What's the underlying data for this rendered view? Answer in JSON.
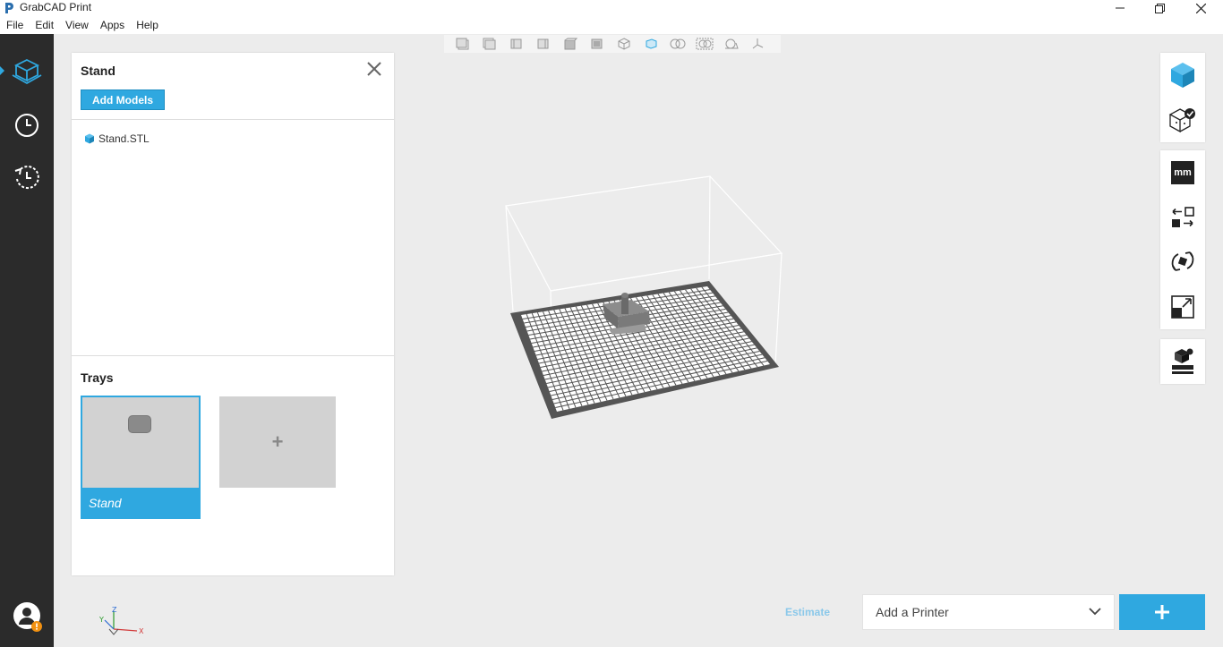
{
  "app": {
    "title": "GrabCAD Print"
  },
  "menu": [
    "File",
    "Edit",
    "View",
    "Apps",
    "Help"
  ],
  "panel": {
    "title": "Stand",
    "add_models_label": "Add Models",
    "models": [
      {
        "name": "Stand.STL"
      }
    ],
    "trays_title": "Trays",
    "trays": [
      {
        "label": "Stand"
      }
    ],
    "add_tray_glyph": "+"
  },
  "units": {
    "label": "mm"
  },
  "bottom": {
    "estimate_label": "Estimate",
    "printer_placeholder": "Add a Printer"
  },
  "gizmo": {
    "z": "Z",
    "y": "Y",
    "x": "X"
  },
  "colors": {
    "accent": "#2fa8e0",
    "rail": "#2b2b2b",
    "viewport": "#ececec",
    "notification": "#f29111"
  },
  "icons": {
    "rail": [
      "cube-outline-icon",
      "clock-icon",
      "history-icon",
      "user-icon"
    ],
    "viewbar": [
      "view-front-icon",
      "view-back-icon",
      "view-left-icon",
      "view-right-icon",
      "view-top-icon",
      "view-bottom-icon",
      "view-iso-icon",
      "view-fit-icon",
      "zoom-icon",
      "zoom-all-icon",
      "section-icon",
      "axes-icon"
    ],
    "right": [
      "model-cube-icon",
      "cube-check-icon",
      "units-icon",
      "move-icon",
      "rotate-icon",
      "scale-icon",
      "support-icon"
    ]
  }
}
